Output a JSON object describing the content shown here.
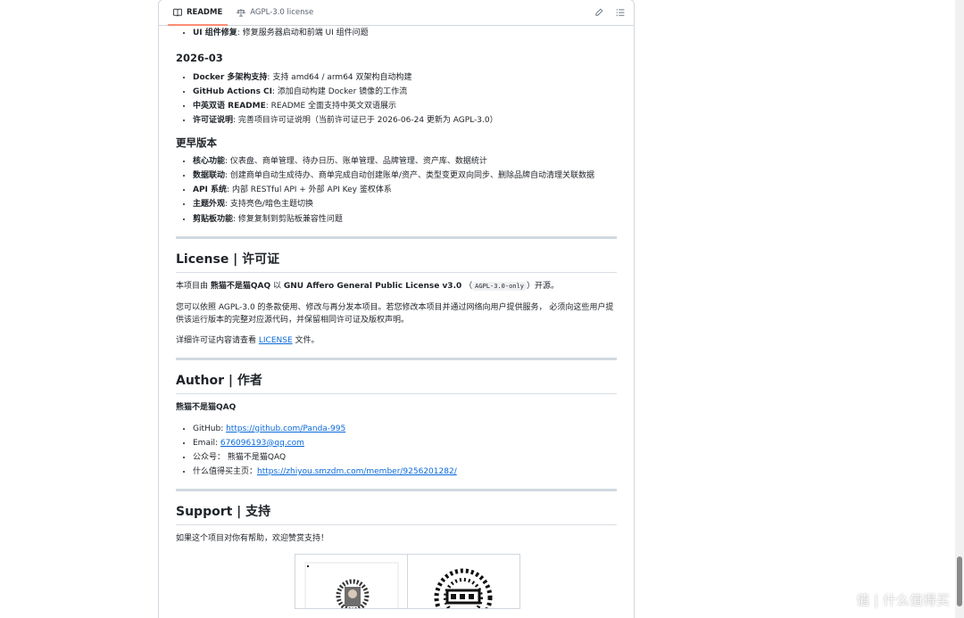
{
  "tabs": {
    "readme": "README",
    "license": "AGPL-3.0 license"
  },
  "changelog": {
    "prev_item": {
      "bold": "UI 组件修复",
      "text": ": 修复服务器启动和前端 UI 组件问题"
    },
    "v2026_03": {
      "heading": "2026-03",
      "items": [
        {
          "bold": "Docker 多架构支持",
          "text": ": 支持 amd64 / arm64 双架构自动构建"
        },
        {
          "bold": "GitHub Actions CI",
          "text": ": 添加自动构建 Docker 镜像的工作流"
        },
        {
          "bold": "中英双语 README",
          "text": ": README 全面支持中英文双语展示"
        },
        {
          "bold": "许可证说明",
          "text": ": 完善项目许可证说明（当前许可证已于 2026-06-24 更新为 AGPL-3.0）"
        }
      ]
    },
    "earlier": {
      "heading": "更早版本",
      "items": [
        {
          "bold": "核心功能",
          "text": ": 仪表盘、商单管理、待办日历、账单管理、品牌管理、资产库、数据统计"
        },
        {
          "bold": "数据联动",
          "text": ": 创建商单自动生成待办、商单完成自动创建账单/资产、类型变更双向同步、删除品牌自动清理关联数据"
        },
        {
          "bold": "API 系统",
          "text": ": 内部 RESTful API + 外部 API Key 鉴权体系"
        },
        {
          "bold": "主题外观",
          "text": ": 支持亮色/暗色主题切换"
        },
        {
          "bold": "剪贴板功能",
          "text": ": 修复复制到剪贴板兼容性问题"
        }
      ]
    }
  },
  "license": {
    "heading": "License | 许可证",
    "p1_prefix": "本项目由 ",
    "p1_author": "熊猫不是猫QAQ",
    "p1_mid": " 以 ",
    "p1_license": "GNU Affero General Public License v3.0",
    "p1_open": " （",
    "p1_code": "AGPL-3.0-only",
    "p1_close": "）开源。",
    "p2": "您可以依照 AGPL-3.0 的条款使用、修改与再分发本项目。若您修改本项目并通过网络向用户提供服务， 必须向这些用户提供该运行版本的完整对应源代码，并保留相同许可证及版权声明。",
    "p3_prefix": "详细许可证内容请查看 ",
    "p3_link": "LICENSE",
    "p3_suffix": " 文件。"
  },
  "author": {
    "heading": "Author | 作者",
    "name": "熊猫不是猫QAQ",
    "github_label": "GitHub: ",
    "github_url": "https://github.com/Panda-995",
    "email_label": "Email: ",
    "email": "676096193@qq.com",
    "wechat": "公众号： 熊猫不是猫QAQ",
    "smzdm_label": "什么值得买主页：",
    "smzdm_url": "https://zhiyou.smzdm.com/member/9256201282/"
  },
  "support": {
    "heading": "Support | 支持",
    "text": "如果这个项目对你有帮助，欢迎赞赏支持！"
  },
  "watermark": "值 | 什么值得买"
}
